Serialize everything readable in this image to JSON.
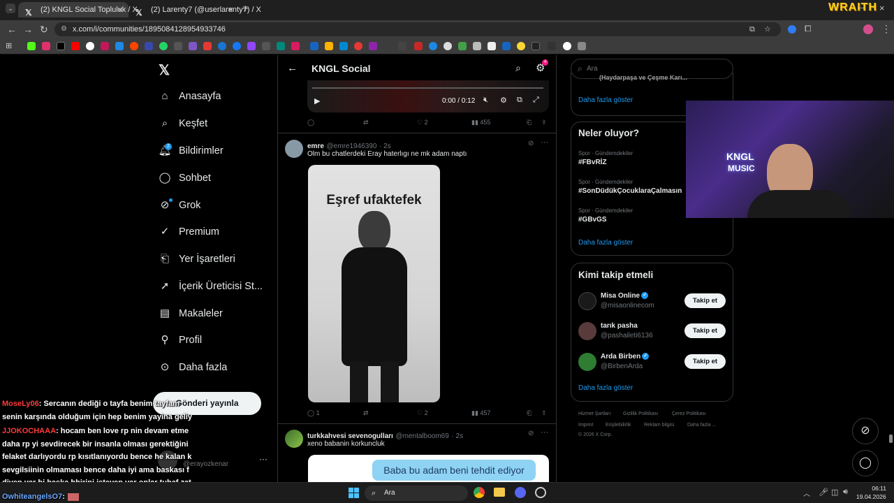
{
  "browser": {
    "tabs": [
      {
        "label": "(2) KNGL Social Topluluk / X"
      },
      {
        "label": "(2) Larenty7 (@userlarenty7) / X"
      }
    ],
    "url": "x.com/i/communities/1895084128954933746"
  },
  "stream_overlay": {
    "brand": "WRAITH",
    "cam_logo_line1": "KNGL",
    "cam_logo_line2": "MUSIC"
  },
  "nav": {
    "items": [
      {
        "label": "Anasayfa"
      },
      {
        "label": "Keşfet"
      },
      {
        "label": "Bildirimler",
        "badge": "2"
      },
      {
        "label": "Sohbet"
      },
      {
        "label": "Grok"
      },
      {
        "label": "Premium"
      },
      {
        "label": "Yer İşaretleri"
      },
      {
        "label": "İçerik Üreticisi St..."
      },
      {
        "label": "Makaleler"
      },
      {
        "label": "Profil"
      },
      {
        "label": "Daha fazla"
      }
    ],
    "post_button": "Gönderi yayınla",
    "account_handle": "@erayozkenar"
  },
  "header": {
    "title": "KNGL Social",
    "settings_badge": "4"
  },
  "video": {
    "time": "0:00 / 0:12"
  },
  "post0_actions": {
    "replies": "",
    "retweets": "",
    "likes": "2",
    "views": "455"
  },
  "post1": {
    "name": "emre",
    "handle": "@emre1946390",
    "time": "· 2s",
    "text": "Olm bu chatlerdeki Eray haterlıgı ne mk adam naptı",
    "image_caption": "Eşref ufaktefek",
    "replies": "1",
    "likes": "2",
    "views": "457"
  },
  "post2": {
    "name": "turkkahvesi sevenogulları",
    "handle": "@mentalboom69",
    "time": "· 2s",
    "text": "xeno babanin korkuncluk",
    "image_caption": "Baba bu adam beni tehdit ediyor"
  },
  "search": {
    "placeholder": "Ara"
  },
  "trends_top": {
    "more": "Daha fazla göster",
    "cut_text": "(Haydarpaşa ve Çeşme Karı..."
  },
  "trends": {
    "title": "Neler oluyor?",
    "items": [
      {
        "category": "Spor · Gündemdekiler",
        "tag": "#FBvRİZ"
      },
      {
        "category": "Spor · Gündemdekiler",
        "tag": "#SonDüdükÇocuklaraÇalmasın"
      },
      {
        "category": "Spor · Gündemdekiler",
        "tag": "#GBvGS"
      }
    ],
    "more": "Daha fazla göster"
  },
  "who_to_follow": {
    "title": "Kimi takip etmeli",
    "users": [
      {
        "name": "Misa Online",
        "handle": "@misaonlinecom",
        "verified": true,
        "button": "Takip et"
      },
      {
        "name": "tarık pasha",
        "handle": "@pashaileti6136",
        "verified": false,
        "button": "Takip et"
      },
      {
        "name": "Arda Birben",
        "handle": "@BirbenArda",
        "verified": true,
        "button": "Takip et"
      }
    ],
    "more": "Daha fazla göster"
  },
  "footer": {
    "links": [
      "Hizmet Şartları",
      "Gizlilik Politikası",
      "Çerez Politikası",
      "İmprint",
      "Erişilebilirlik",
      "Reklam bilgisi",
      "Daha fazla ..."
    ],
    "copyright": "© 2026 X Corp."
  },
  "chat": [
    {
      "user": "MoseLy06",
      "color": "#ff3b3b",
      "text": ": Sercanın dediği o tayfa benim tayfam"
    },
    {
      "user": "",
      "color": "#ffffff",
      "text": "senin karşında olduğum için hep benim yayina geliy"
    },
    {
      "user": "JJOKOCHAAA",
      "color": "#ff3b3b",
      "text": ": hocam ben love rp nin devam etme"
    },
    {
      "user": "",
      "color": "#ffffff",
      "text": "daha rp yi sevdirecek bir insanla olması gerektiğini"
    },
    {
      "user": "",
      "color": "#ffffff",
      "text": "felaket darlıyordu rp kısıtlanıyordu bence he kalan k"
    },
    {
      "user": "",
      "color": "#ffffff",
      "text": "sevgilsiinin olmaması bence daha iyi ama baskası f"
    },
    {
      "user": "",
      "color": "#ffffff",
      "text": "diyen var bi baska bbirini isteyen var onlar tuhaf zat"
    },
    {
      "user": "OwhiteangelsO7",
      "color": "#6aa8ff",
      "text": ":"
    }
  ],
  "taskbar": {
    "search": "Ara",
    "time": "06:11",
    "date": "19.04.2026"
  }
}
